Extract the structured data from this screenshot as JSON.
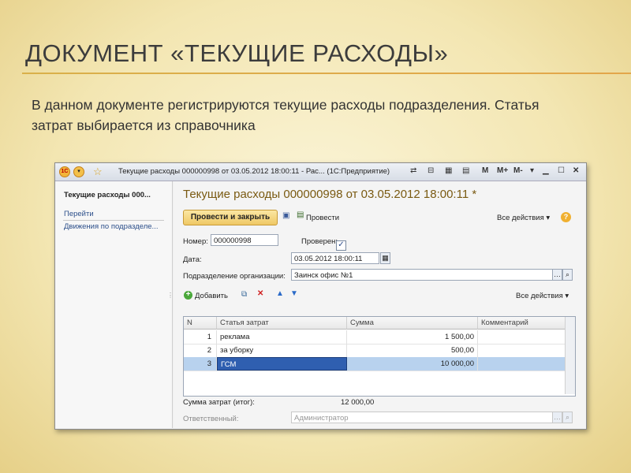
{
  "slide": {
    "title": "ДОКУМЕНТ «ТЕКУЩИЕ РАСХОДЫ»",
    "body": "В данном документе регистрируются текущие расходы подразделения. Статья затрат выбирается из справочника"
  },
  "window": {
    "title": "Текущие расходы 000000998 от 03.05.2012 18:00:11 - Рас... (1С:Предприятие)",
    "app_badge": "1С",
    "controls": [
      "M",
      "M+",
      "M-"
    ]
  },
  "sidebar": {
    "doc_link": "Текущие расходы 000...",
    "section": "Перейти",
    "item": "Движения по подразделе..."
  },
  "doc": {
    "heading": "Текущие расходы 000000998 от 03.05.2012 18:00:11 *",
    "post_close_label": "Провести и закрыть",
    "post_label": "Провести",
    "all_actions": "Все действия ▾",
    "help": "?",
    "number_label": "Номер:",
    "number_value": "000000998",
    "checked_label": "Проверен:",
    "date_label": "Дата:",
    "date_value": "03.05.2012 18:00:11",
    "org_label": "Подразделение организации:",
    "org_value": "Заинск офис №1",
    "add_label": "Добавить",
    "table_all_actions": "Все действия ▾",
    "table": {
      "headers": [
        "N",
        "Статья затрат",
        "Сумма",
        "Комментарий"
      ],
      "rows": [
        {
          "n": "1",
          "item": "реклама",
          "sum": "1 500,00",
          "comment": ""
        },
        {
          "n": "2",
          "item": "за уборку",
          "sum": "500,00",
          "comment": ""
        },
        {
          "n": "3",
          "item": "ГСМ",
          "sum": "10 000,00",
          "comment": ""
        }
      ]
    },
    "total_label": "Сумма затрат (итог):",
    "total_value": "12 000,00",
    "responsible_label": "Ответственный:",
    "responsible_value": "Администратор"
  }
}
